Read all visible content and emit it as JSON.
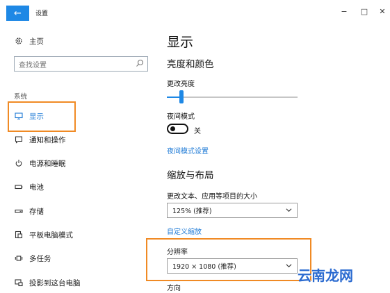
{
  "window": {
    "title": "设置",
    "back_glyph": "←",
    "minimize_glyph": "−",
    "maximize_glyph": "□",
    "close_glyph": "✕"
  },
  "sidebar": {
    "home_label": "主页",
    "search_placeholder": "查找设置",
    "section_label": "系统",
    "items": [
      {
        "label": "显示",
        "icon": "monitor-icon",
        "selected": true
      },
      {
        "label": "通知和操作",
        "icon": "notification-icon"
      },
      {
        "label": "电源和睡眠",
        "icon": "power-icon"
      },
      {
        "label": "电池",
        "icon": "battery-icon"
      },
      {
        "label": "存储",
        "icon": "storage-icon"
      },
      {
        "label": "平板电脑模式",
        "icon": "tablet-mode-icon"
      },
      {
        "label": "多任务",
        "icon": "multitask-icon"
      },
      {
        "label": "投影到这台电脑",
        "icon": "project-icon"
      }
    ]
  },
  "main": {
    "page_title": "显示",
    "brightness_section": "亮度和颜色",
    "brightness_label": "更改亮度",
    "brightness_level": 0.11,
    "night_mode_label": "夜间模式",
    "night_mode_state": "关",
    "night_mode_settings_link": "夜间模式设置",
    "scale_section": "缩放与布局",
    "scale_label": "更改文本、应用等项目的大小",
    "scale_value": "125% (推荐)",
    "custom_scale_link": "自定义缩放",
    "resolution_label": "分辨率",
    "resolution_value": "1920 × 1080 (推荐)",
    "orientation_label": "方向"
  },
  "watermark": "云南龙网",
  "colors": {
    "accent": "#1e88e5",
    "highlight": "#f08a24",
    "link": "#1e7ad6"
  }
}
